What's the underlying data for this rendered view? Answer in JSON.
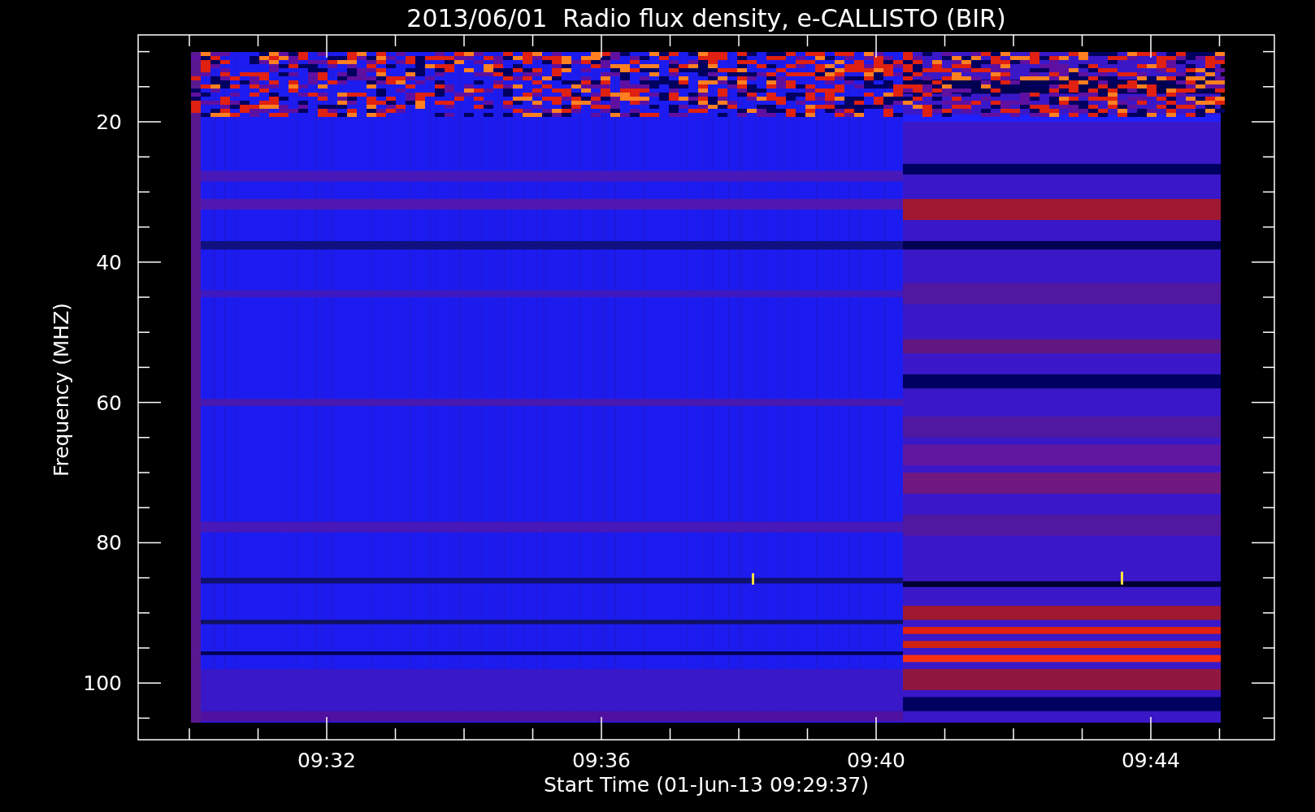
{
  "title": "2013/06/01  Radio flux density, e-CALLISTO (BIR)",
  "y_axis": {
    "label": "Frequency (MHZ)",
    "ticks": [
      "20",
      "40",
      "60",
      "80",
      "100"
    ]
  },
  "x_axis": {
    "label": "Start Time (01-Jun-13 09:29:37)",
    "ticks": [
      "09:32",
      "09:36",
      "09:40",
      "09:44"
    ]
  }
}
